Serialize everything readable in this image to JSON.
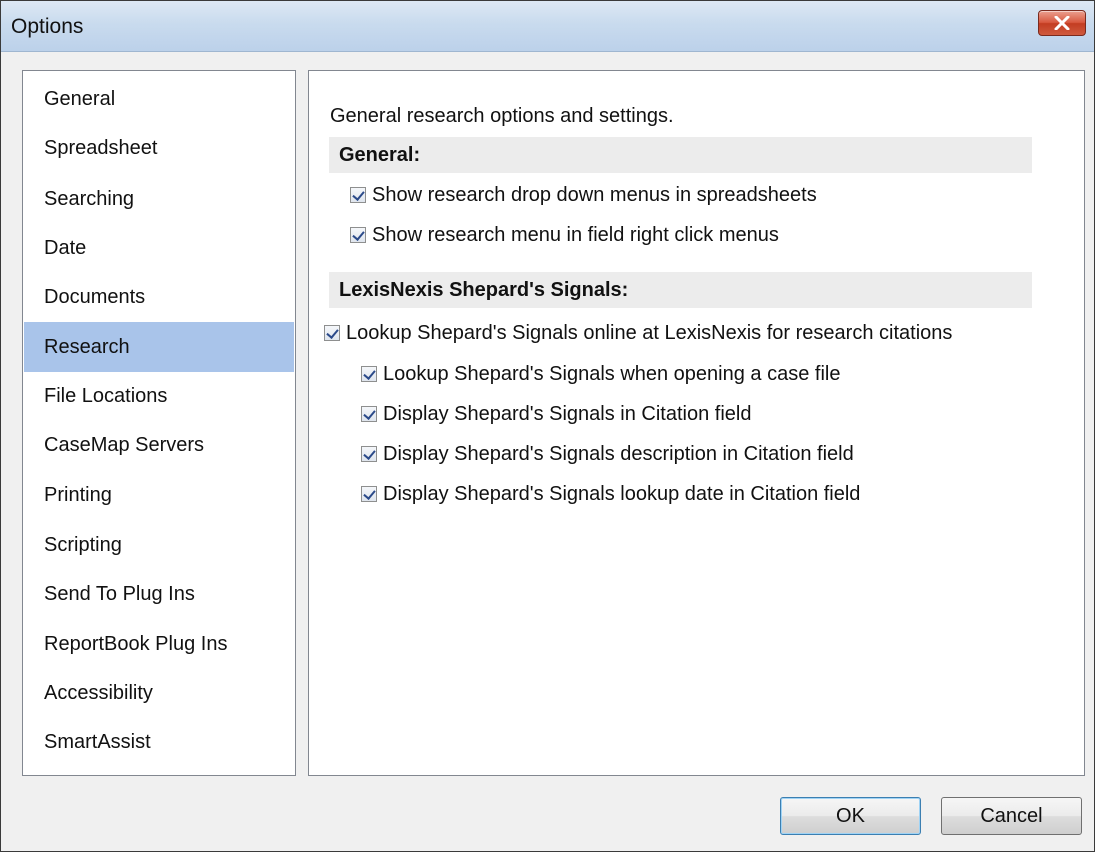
{
  "window": {
    "title": "Options"
  },
  "sidebar": {
    "items": [
      {
        "label": "General"
      },
      {
        "label": "Spreadsheet"
      },
      {
        "label": "Searching"
      },
      {
        "label": "Date"
      },
      {
        "label": "Documents"
      },
      {
        "label": "Research",
        "selected": true
      },
      {
        "label": "File Locations"
      },
      {
        "label": "CaseMap Servers"
      },
      {
        "label": "Printing"
      },
      {
        "label": "Scripting"
      },
      {
        "label": "Send To Plug Ins"
      },
      {
        "label": "ReportBook Plug Ins"
      },
      {
        "label": "Accessibility"
      },
      {
        "label": "SmartAssist"
      }
    ]
  },
  "content": {
    "description": "General research options and settings.",
    "general_section": {
      "header": "General:",
      "options": [
        {
          "label": "Show research drop down menus in spreadsheets",
          "checked": true
        },
        {
          "label": "Show research menu in field right click menus",
          "checked": true
        }
      ]
    },
    "shepards_section": {
      "header": "LexisNexis Shepard's Signals:",
      "main_option": {
        "label": "Lookup Shepard's Signals online at LexisNexis for research citations",
        "checked": true
      },
      "sub_options": [
        {
          "label": "Lookup Shepard's Signals when opening a case file",
          "checked": true
        },
        {
          "label": "Display Shepard's Signals in Citation field",
          "checked": true
        },
        {
          "label": "Display Shepard's Signals description in Citation field",
          "checked": true
        },
        {
          "label": "Display Shepard's Signals lookup date in Citation field",
          "checked": true
        }
      ]
    }
  },
  "buttons": {
    "ok": "OK",
    "cancel": "Cancel"
  },
  "colors": {
    "selection": "#a9c4ea",
    "section_header_bg": "#ececec",
    "close_button": "#c94b31"
  },
  "icons": {
    "close": "close-icon",
    "checkbox": "checkmark-icon"
  }
}
